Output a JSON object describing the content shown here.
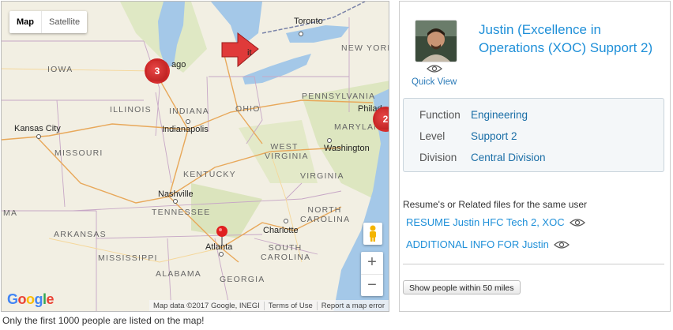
{
  "map": {
    "type_controls": [
      "Map",
      "Satellite"
    ],
    "state_labels": [
      "IOWA",
      "ILLINOIS",
      "INDIANA",
      "OHIO",
      "PENNSYLVANIA",
      "NEW YORK",
      "MISSOURI",
      "WEST VIRGINIA",
      "VIRGINIA",
      "KENTUCKY",
      "TENNESSEE",
      "NORTH CAROLINA",
      "SOUTH CAROLINA",
      "ARKANSAS",
      "MISSISSIPPI",
      "ALABAMA",
      "GEORGIA",
      "MARYLAND"
    ],
    "city_labels": [
      "Toronto",
      "Kansas City",
      "Indianapolis",
      "Washington",
      "Nashville",
      "Charlotte",
      "Atlanta",
      "Philad"
    ],
    "clusters": [
      "3",
      "2"
    ],
    "lake_label_fragments": [
      "ago",
      "it"
    ],
    "attribution": [
      "Map data ©2017 Google, INEGI",
      "Terms of Use",
      "Report a map error"
    ],
    "logo": "Google",
    "zoom_in": "+",
    "zoom_out": "−",
    "stub": "MA"
  },
  "note": "Only the first 1000 people are listed on the map!",
  "profile": {
    "name": "Justin (Excellence in Operations (XOC) Support 2)",
    "quick_view": "Quick View",
    "fields": [
      {
        "label": "Function",
        "value": "Engineering"
      },
      {
        "label": "Level",
        "value": "Support 2"
      },
      {
        "label": "Division",
        "value": "Central Division"
      }
    ],
    "related_title": "Resume's or Related files for the same user",
    "files": [
      "RESUME Justin HFC Tech 2, XOC",
      "ADDITIONAL INFO FOR Justin"
    ],
    "button": "Show people within 50 miles"
  },
  "colors": {
    "link": "#1e8fd8",
    "cluster": "#d32f2f",
    "map_land": "#f3eedd",
    "water": "#a4c8e8"
  }
}
